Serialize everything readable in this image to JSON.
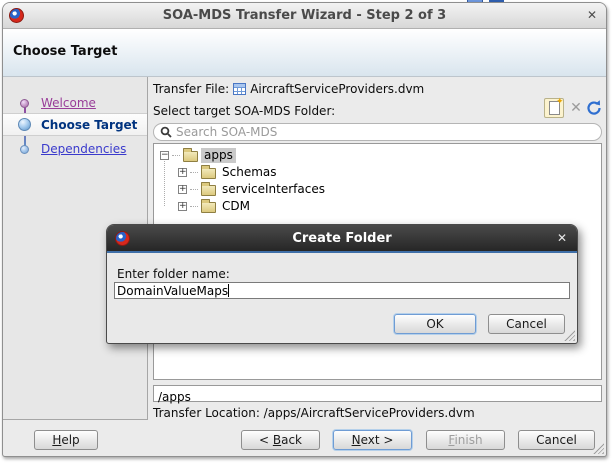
{
  "window": {
    "title": "SOA-MDS Transfer Wizard - Step 2 of 3",
    "header_title": "Choose Target",
    "close_glyph": "✕"
  },
  "sidebar": {
    "items": [
      {
        "label": "Welcome",
        "state": "visited"
      },
      {
        "label": "Choose Target",
        "state": "current"
      },
      {
        "label": "Dependencies",
        "state": "upcoming"
      }
    ]
  },
  "content": {
    "transfer_file_label": "Transfer File:",
    "transfer_file_name": "AircraftServiceProviders.dvm",
    "select_target_label": "Select target SOA-MDS Folder:",
    "search_placeholder": "Search SOA-MDS",
    "tree": {
      "root": "apps",
      "children": [
        "Schemas",
        "serviceInterfaces",
        "CDM"
      ]
    },
    "path_value": "/apps",
    "transfer_location": "Transfer Location: /apps/AircraftServiceProviders.dvm"
  },
  "dialog": {
    "title": "Create Folder",
    "close_glyph": "✕",
    "prompt_label": "Enter folder name:",
    "input_value": "DomainValueMaps",
    "ok_label": "OK",
    "cancel_label": "Cancel"
  },
  "footer": {
    "help": {
      "key": "H",
      "post": "elp"
    },
    "back": {
      "pre": "< ",
      "key": "B",
      "post": "ack"
    },
    "next": {
      "key": "N",
      "post": "ext >"
    },
    "finish": {
      "key": "F",
      "post": "inish"
    },
    "cancel_label": "Cancel"
  },
  "icons": {
    "collapse_minus": "−",
    "expand_plus": "+",
    "new_folder_star": "✦",
    "delete_x": "✕"
  },
  "colors": {
    "accent-blue": "#3f6fa8",
    "link-purple": "#993d99",
    "link-blue": "#3a3acc",
    "step-navy": "#00337f",
    "sphere-blue": "#5b94c9",
    "tree-sel": "#c9c9c9",
    "folder-light": "#f2e9bb",
    "folder-dark": "#dcc97e"
  }
}
